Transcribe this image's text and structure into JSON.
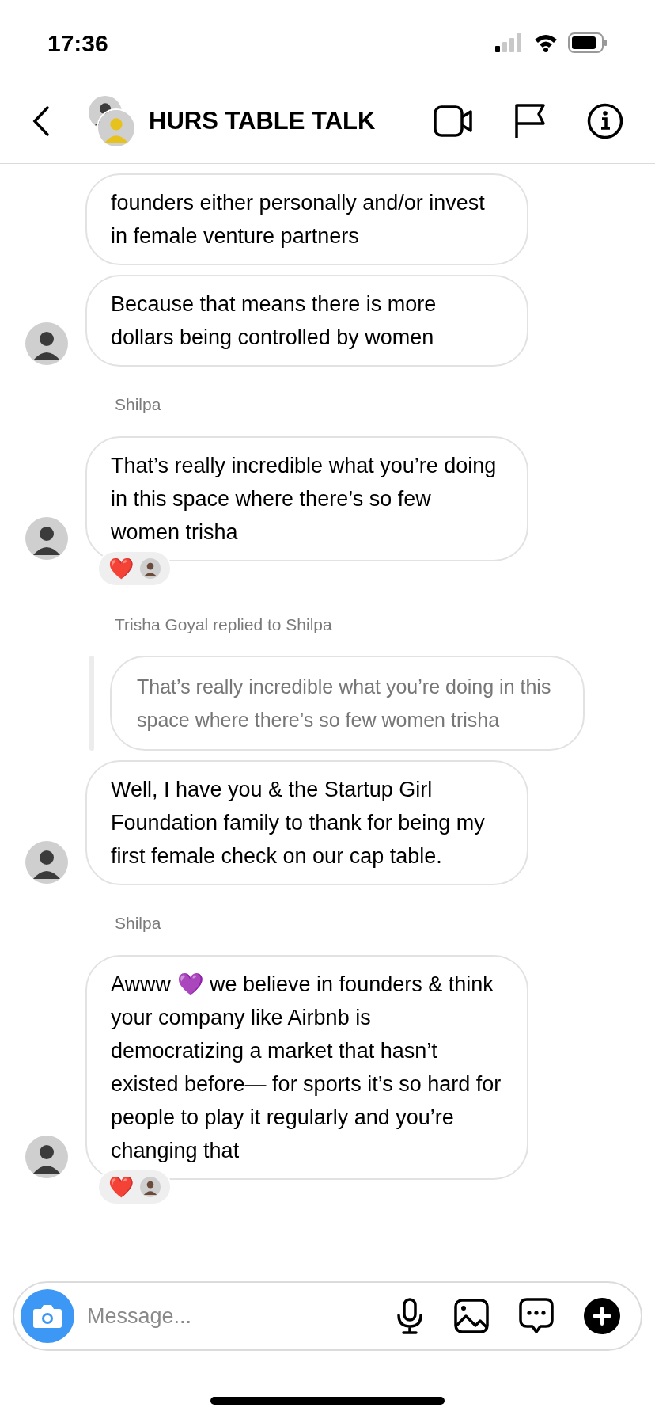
{
  "status_bar": {
    "time": "17:36"
  },
  "header": {
    "title": "HURS TABLE TALK"
  },
  "messages": [
    {
      "kind": "bubble",
      "text": "founders either personally and/or invest in female venture partners",
      "avatar": false
    },
    {
      "kind": "bubble",
      "text": "Because that means there is more dollars being controlled by women",
      "avatar": true
    },
    {
      "kind": "sender",
      "text": "Shilpa"
    },
    {
      "kind": "bubble",
      "text": "That’s really incredible what you’re doing in this space where there’s so few women trisha",
      "avatar": true,
      "reaction": "❤️"
    },
    {
      "kind": "sender",
      "text": "Trisha Goyal replied to Shilpa"
    },
    {
      "kind": "quote",
      "text": "That’s really incredible what you’re doing in this space where there’s so few women trisha"
    },
    {
      "kind": "bubble",
      "text": "Well, I have you & the Startup Girl Foundation family to thank for being my first female check on our cap table.",
      "avatar": true
    },
    {
      "kind": "sender",
      "text": "Shilpa"
    },
    {
      "kind": "bubble",
      "text": "Awww 💜 we believe in founders & think your company like Airbnb is democratizing a market that hasn’t existed before— for sports it’s so hard for people to play it regularly and you’re changing that",
      "avatar": true,
      "reaction": "❤️"
    }
  ],
  "composer": {
    "placeholder": "Message..."
  }
}
